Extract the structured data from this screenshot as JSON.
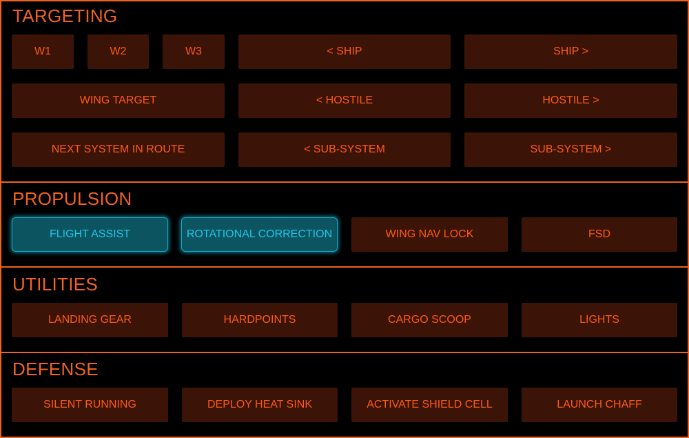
{
  "colors": {
    "accent": "#f2621f",
    "button_bg": "#3c1407",
    "button_text": "#ff5a12",
    "active_bg": "#0c5560",
    "active_text": "#21c5ea",
    "background": "#000000"
  },
  "targeting": {
    "title": "TARGETING",
    "w1": "W1",
    "w2": "W2",
    "w3": "W3",
    "prev_ship": "< SHIP",
    "next_ship": "SHIP >",
    "wing_target": "WING TARGET",
    "prev_hostile": "< HOSTILE",
    "next_hostile": "HOSTILE >",
    "next_system": "NEXT SYSTEM IN ROUTE",
    "prev_subsystem": "< SUB-SYSTEM",
    "next_subsystem": "SUB-SYSTEM >"
  },
  "propulsion": {
    "title": "PROPULSION",
    "flight_assist": "FLIGHT ASSIST",
    "rotational_correction": "ROTATIONAL CORRECTION",
    "wing_nav_lock": "WING NAV LOCK",
    "fsd": "FSD",
    "active_toggles": [
      "FLIGHT ASSIST",
      "ROTATIONAL CORRECTION"
    ]
  },
  "utilities": {
    "title": "UTILITIES",
    "landing_gear": "LANDING GEAR",
    "hardpoints": "HARDPOINTS",
    "cargo_scoop": "CARGO SCOOP",
    "lights": "LIGHTS"
  },
  "defense": {
    "title": "DEFENSE",
    "silent_running": "SILENT RUNNING",
    "deploy_heat_sink": "DEPLOY HEAT SINK",
    "activate_shield_cell": "ACTIVATE SHIELD CELL",
    "launch_chaff": "LAUNCH CHAFF"
  }
}
